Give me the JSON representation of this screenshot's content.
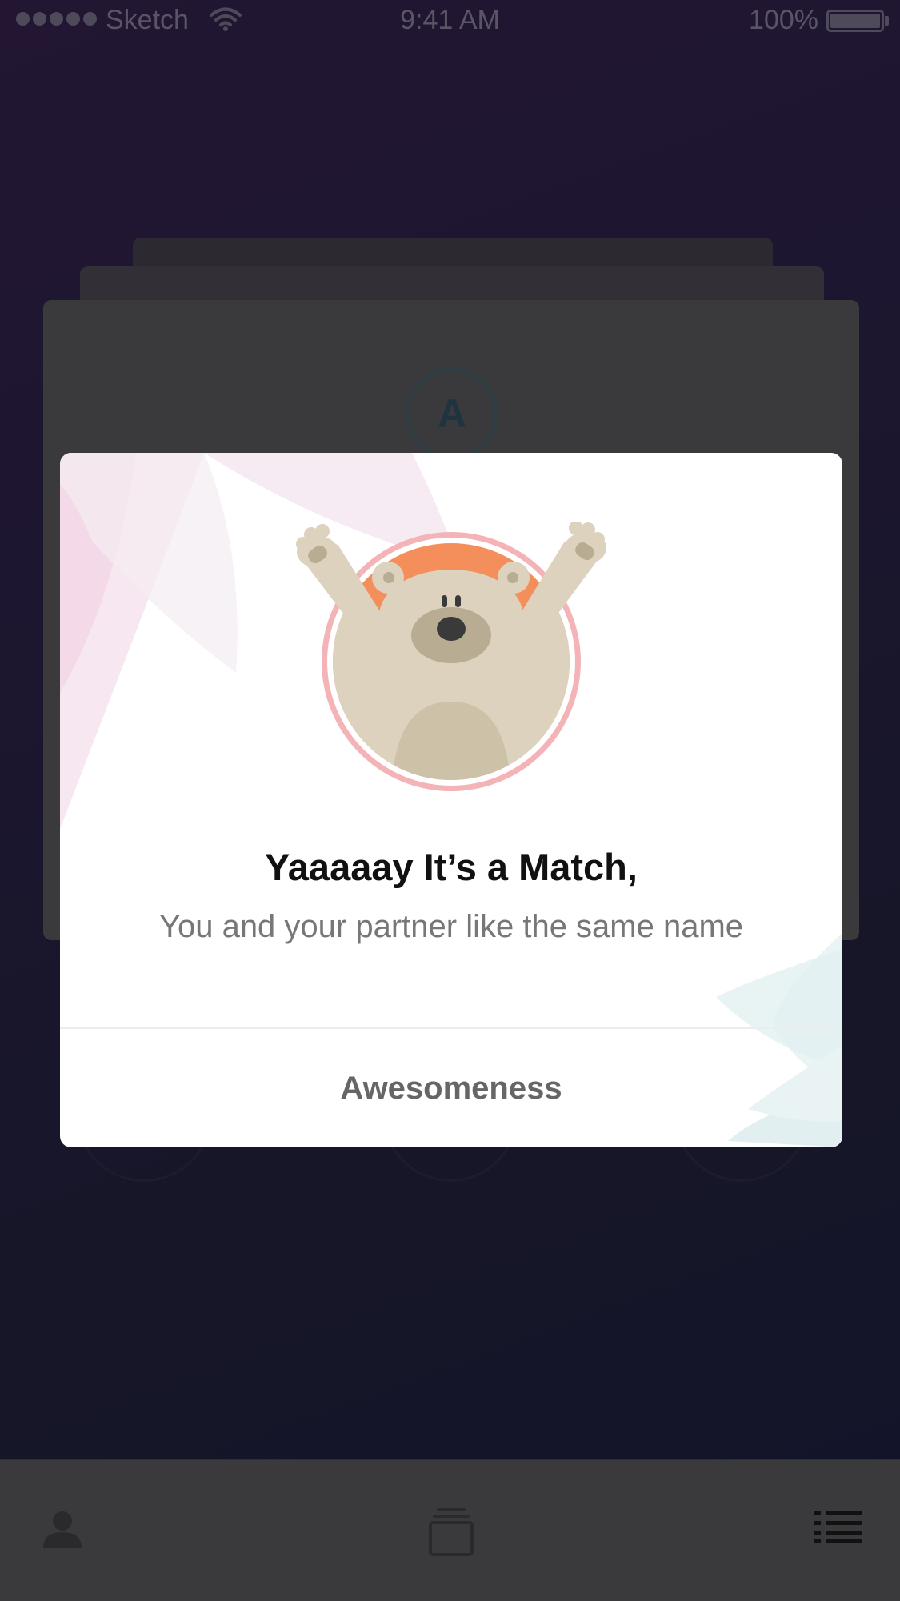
{
  "status_bar": {
    "carrier": "Sketch",
    "time": "9:41 AM",
    "battery": "100%",
    "signal_icon": "signal-dots-icon",
    "wifi_icon": "wifi-icon",
    "battery_icon": "battery-icon"
  },
  "card": {
    "letter": "A"
  },
  "modal": {
    "title": "Yaaaaay It’s a Match,",
    "subtitle": "You and your partner like the same name",
    "button_label": "Awesomeness",
    "illustration": "bear-cheering-icon"
  },
  "tab_bar": {
    "tabs": [
      {
        "icon": "profile-icon"
      },
      {
        "icon": "cards-stack-icon"
      },
      {
        "icon": "list-icon"
      }
    ]
  },
  "colors": {
    "overlay_bg": "#1a152b",
    "modal_bg": "#ffffff",
    "title": "#111111",
    "subtitle": "#777777",
    "button_text": "#666666",
    "accent_orange": "#f48f5c",
    "accent_pink": "#f4b3b7",
    "bear": "#ddd2be"
  }
}
